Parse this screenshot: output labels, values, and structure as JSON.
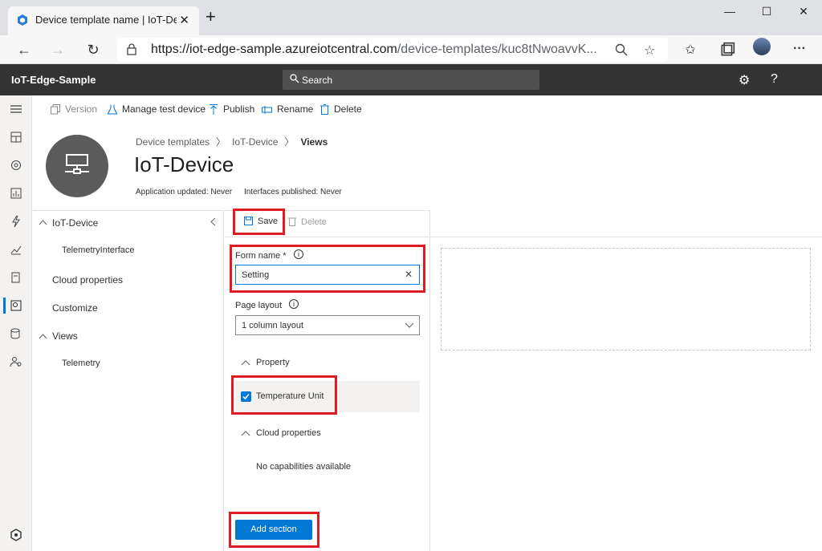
{
  "browser": {
    "tab_title": "Device template name | IoT-Devi",
    "url_domain": "https://iot-edge-sample.azureiotcentral.com",
    "url_path": "/device-templates/kuc8tNwoavvK...",
    "new_tab": "+",
    "win_min": "—",
    "win_max": "☐",
    "win_close": "✕",
    "tab_close": "✕"
  },
  "app": {
    "name": "IoT-Edge-Sample",
    "search_placeholder": "Search",
    "help": "?"
  },
  "commands": {
    "version": "Version",
    "manage_test_device": "Manage test device",
    "publish": "Publish",
    "rename": "Rename",
    "delete": "Delete"
  },
  "breadcrumb": {
    "items": [
      "Device templates",
      "IoT-Device",
      "Views"
    ],
    "sep": ">"
  },
  "header": {
    "title": "IoT-Device",
    "app_updated": "Application updated: Never",
    "interfaces_published": "Interfaces published: Never"
  },
  "tree": {
    "root": "IoT-Device",
    "interface": "TelemetryInterface",
    "cloud_properties": "Cloud properties",
    "customize": "Customize",
    "views": "Views",
    "telemetry": "Telemetry"
  },
  "form_toolbar": {
    "save": "Save",
    "delete": "Delete"
  },
  "form": {
    "form_name_label": "Form name *",
    "form_name_value": "Setting",
    "page_layout_label": "Page layout",
    "page_layout_value": "1 column layout",
    "property_section": "Property",
    "property_item": "Temperature Unit",
    "cloud_section": "Cloud properties",
    "no_capabilities": "No capabilities available",
    "add_section": "Add section",
    "info": "i"
  },
  "colors": {
    "accent": "#0078d4",
    "header_bg": "#333333",
    "highlight": "#e01b24"
  }
}
